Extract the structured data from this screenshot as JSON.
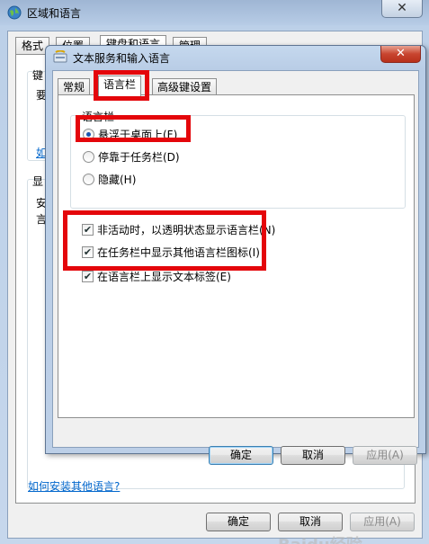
{
  "outer_window": {
    "title": "区域和语言",
    "close_glyph": "✕",
    "tabs": [
      "格式",
      "位置",
      "键盘和语言",
      "管理"
    ],
    "partial_texts": [
      "键",
      "要",
      "如",
      "显",
      "安",
      "言"
    ],
    "link": "如何安装其他语言?",
    "buttons": {
      "ok": "确定",
      "cancel": "取消",
      "apply": "应用(A)"
    },
    "watermark": "Baidu经验"
  },
  "inner_window": {
    "title": "文本服务和输入语言",
    "close_glyph": "✕",
    "tabs": [
      "常规",
      "语言栏",
      "高级键设置"
    ],
    "active_tab": "语言栏",
    "group": {
      "legend": "语言栏",
      "radios": [
        {
          "label": "悬浮于桌面上(F)",
          "selected": true
        },
        {
          "label": "停靠于任务栏(D)",
          "selected": false
        },
        {
          "label": "隐藏(H)",
          "selected": false
        }
      ]
    },
    "checkboxes": [
      {
        "label": "非活动时，以透明状态显示语言栏(N)",
        "checked": true
      },
      {
        "label": "在任务栏中显示其他语言栏图标(I)",
        "checked": true
      },
      {
        "label": "在语言栏上显示文本标签(E)",
        "checked": true
      }
    ],
    "check_glyph": "✔",
    "buttons": {
      "ok": "确定",
      "cancel": "取消",
      "apply": "应用(A)"
    }
  },
  "colors": {
    "highlight": "#e4060b",
    "link": "#0066cc",
    "title_bar": "#b9cde6"
  }
}
